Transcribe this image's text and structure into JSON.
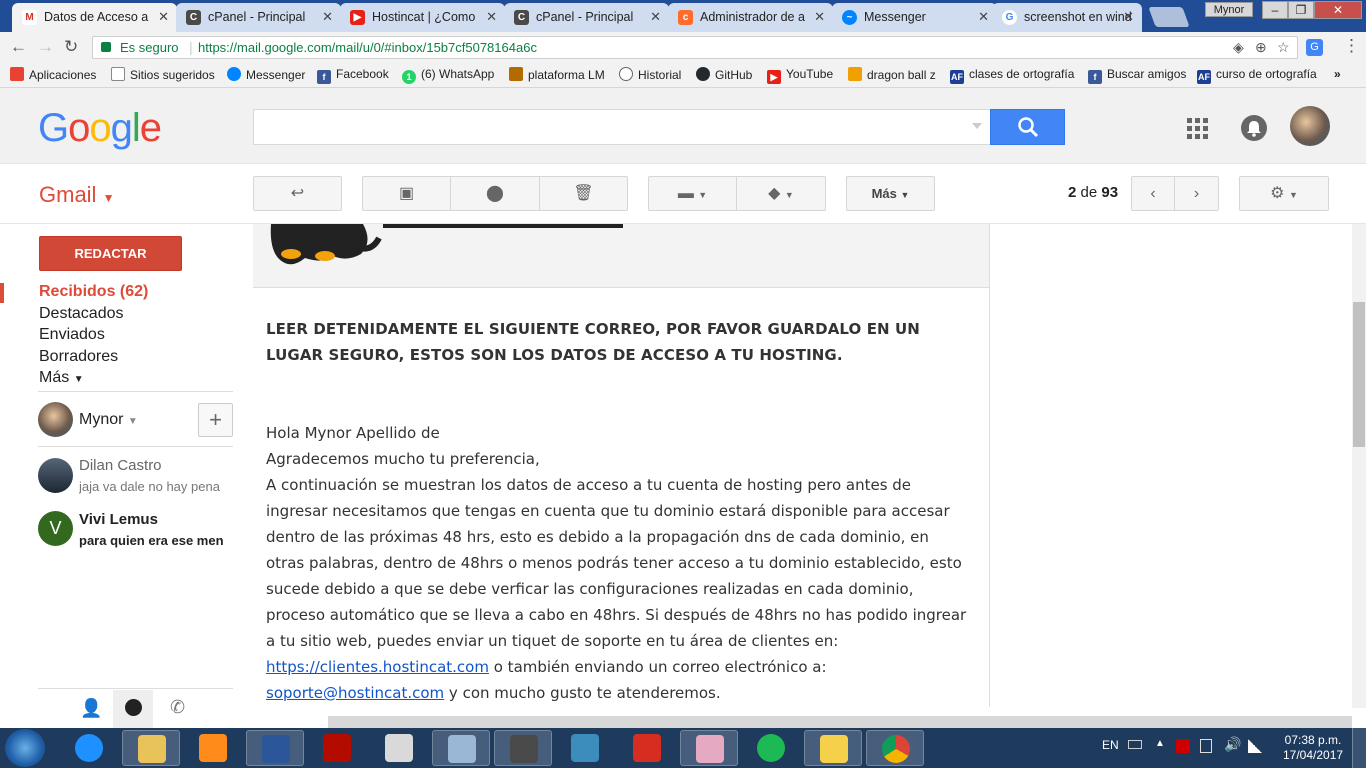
{
  "browser": {
    "tabs": [
      {
        "title": "Datos de Acceso a",
        "icon": "gmail-icon",
        "color": "#d93025"
      },
      {
        "title": "cPanel - Principal",
        "icon": "cpanel-cat-icon",
        "color": "#4a4a4a"
      },
      {
        "title": "Hostincat | ¿Como",
        "icon": "youtube-icon",
        "color": "#e62117"
      },
      {
        "title": "cPanel - Principal",
        "icon": "cpanel-cat-icon",
        "color": "#4a4a4a"
      },
      {
        "title": "Administrador de a",
        "icon": "cpanel-icon",
        "color": "#ff6c2c"
      },
      {
        "title": "Messenger",
        "icon": "messenger-icon",
        "color": "#0084ff"
      },
      {
        "title": "screenshot en wind",
        "icon": "google-icon",
        "color": "#4285f4"
      }
    ],
    "profile_name": "Mynor",
    "secure_label": "Es seguro",
    "url": "https://mail.google.com/mail/u/0/#inbox/15b7cf5078164a6c",
    "bookmarks": [
      {
        "label": "Aplicaciones",
        "icon": "apps-grid-icon",
        "color": "#e94235"
      },
      {
        "label": "Sitios sugeridos",
        "icon": "page-icon",
        "color": "#888888"
      },
      {
        "label": "Messenger",
        "icon": "messenger-icon",
        "color": "#0084ff"
      },
      {
        "label": "Facebook",
        "icon": "facebook-icon",
        "color": "#3b5998"
      },
      {
        "label": "(6) WhatsApp",
        "icon": "whatsapp-icon",
        "color": "#25d366"
      },
      {
        "label": "plataforma LM",
        "icon": "lm-icon",
        "color": "#b36b00"
      },
      {
        "label": "Historial",
        "icon": "history-icon",
        "color": "#666666"
      },
      {
        "label": "GitHub",
        "icon": "github-icon",
        "color": "#24292e"
      },
      {
        "label": "YouTube",
        "icon": "youtube-icon",
        "color": "#e62117"
      },
      {
        "label": "dragon ball z",
        "icon": "dragonball-icon",
        "color": "#f0a000"
      },
      {
        "label": "clases de ortografía",
        "icon": "af-icon",
        "color": "#1c3f94"
      },
      {
        "label": "Buscar amigos",
        "icon": "facebook-icon",
        "color": "#3b5998"
      },
      {
        "label": "curso de ortografía",
        "icon": "af-icon",
        "color": "#1c3f94"
      }
    ],
    "bookmarks_overflow": "»"
  },
  "google": {
    "logo_text": "Google",
    "search_value": ""
  },
  "gmail": {
    "label": "Gmail",
    "more_label": "Más",
    "pager": {
      "current": "2",
      "of": "de",
      "total": "93"
    },
    "compose_label": "REDACTAR",
    "nav": [
      {
        "label": "Recibidos (62)"
      },
      {
        "label": "Destacados"
      },
      {
        "label": "Enviados"
      },
      {
        "label": "Borradores"
      },
      {
        "label": "Más"
      }
    ],
    "hangouts": {
      "self_name": "Mynor",
      "contacts": [
        {
          "name": "Dilan Castro",
          "snippet": "jaja va dale no hay pena",
          "unread": false
        },
        {
          "name": "Vivi Lemus",
          "snippet": "para quien era ese men",
          "unread": true,
          "initial": "V"
        }
      ]
    }
  },
  "email": {
    "title": "LEER DETENIDAMENTE EL SIGUIENTE CORREO, POR FAVOR GUARDALO EN UN LUGAR SEGURO, ESTOS SON LOS DATOS DE ACCESO A TU HOSTING.",
    "greeting": "Hola Mynor Apellido de",
    "thanks": "Agradecemos mucho tu preferencia,",
    "body_part1": "A continuación se muestran los datos de acceso a tu cuenta de hosting pero antes de ingresar necesitamos que tengas en cuenta que tu dominio estará disponible para accesar dentro de las próximas 48 hrs, esto es debido a la propagación dns de cada dominio, en otras palabras, dentro de 48hrs o menos podrás tener acceso a tu dominio establecido, esto sucede debido a que se debe verficar las configuraciones realizadas en cada dominio, proceso automático que se lleva a cabo en 48hrs. Si después de 48hrs no has podido ingrear a tu sitio web, puedes enviar un tiquet de soporte en tu área de clientes en: ",
    "link1": "https://clientes.hostincat.com",
    "body_part2": " o también enviando un correo electrónico a: ",
    "link2": "soporte@hostincat.com",
    "body_part3": " y con mucho gusto te atenderemos."
  },
  "taskbar": {
    "language": "EN",
    "time": "07:38 p.m.",
    "date": "17/04/2017"
  }
}
